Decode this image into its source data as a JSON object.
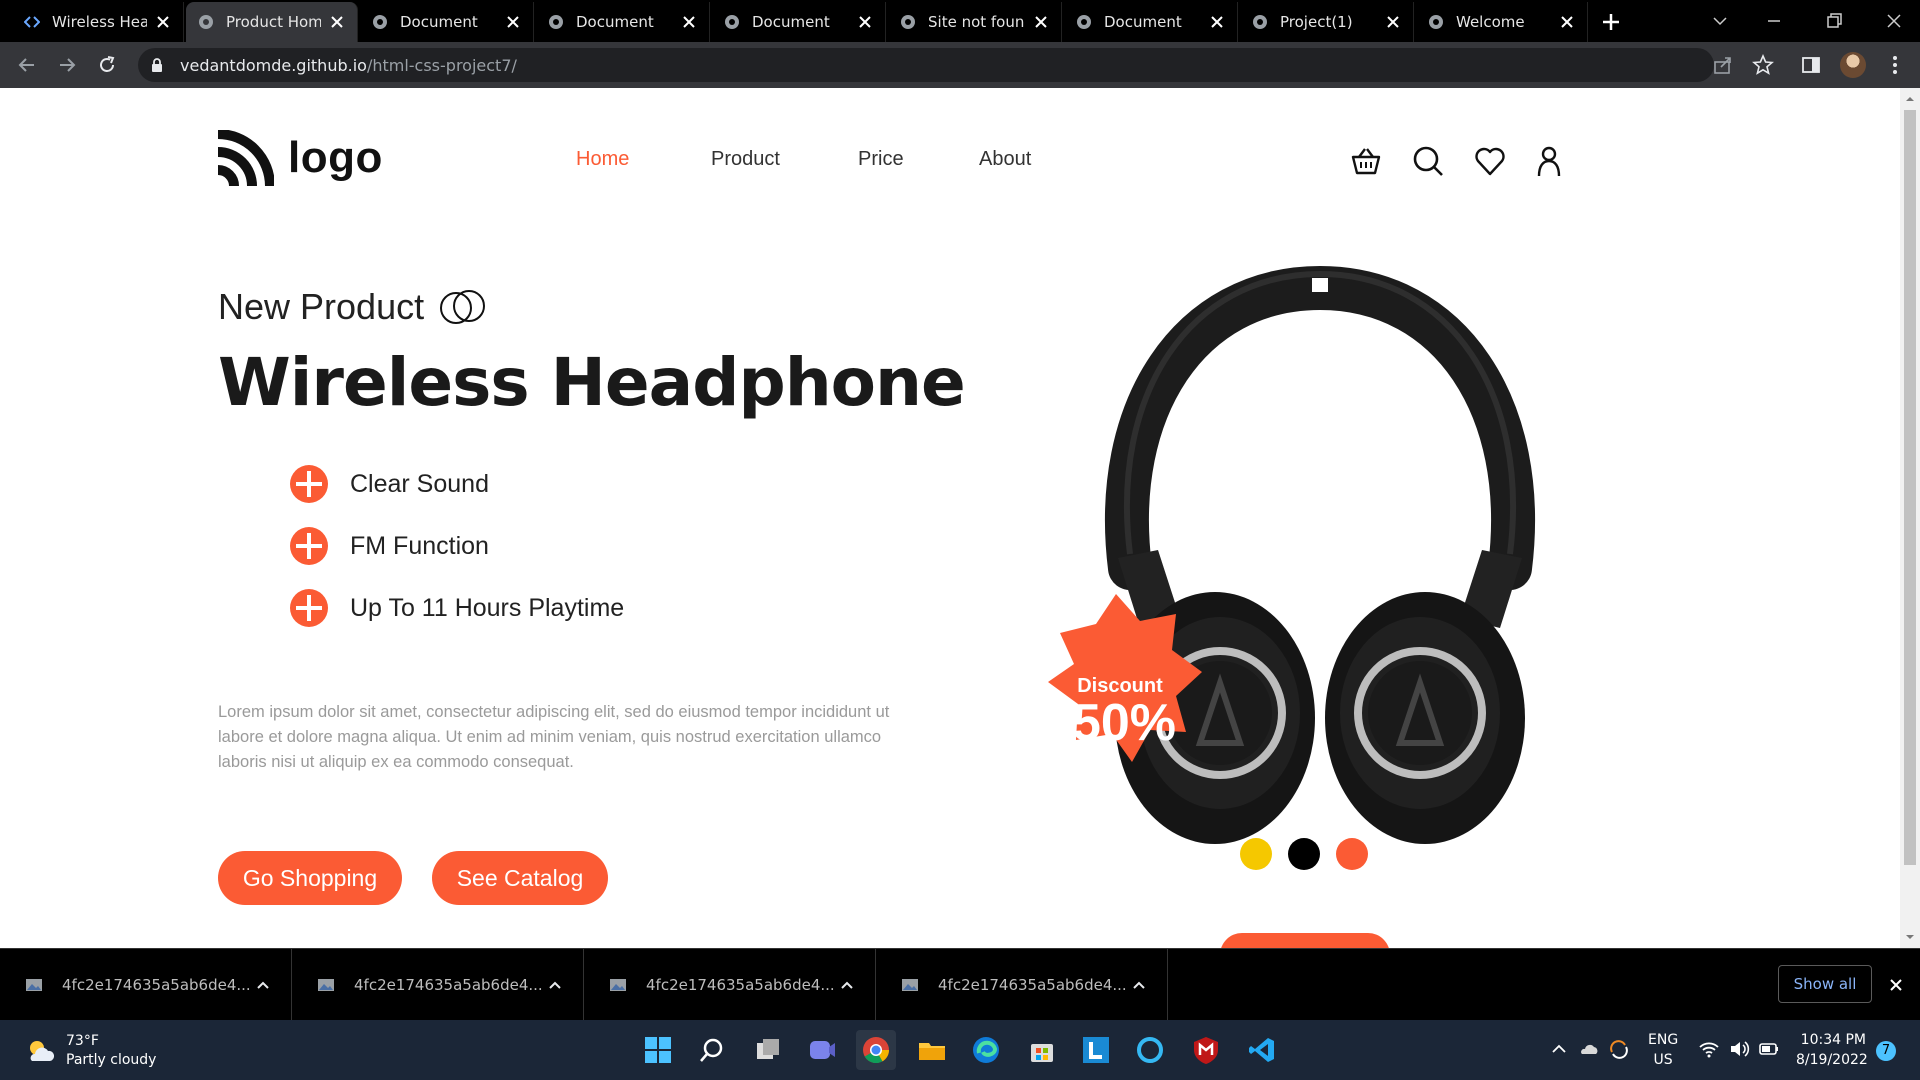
{
  "browser": {
    "tabs": [
      {
        "title": "Wireless Head",
        "active": false,
        "icon": "code-icon"
      },
      {
        "title": "Product Home",
        "active": true,
        "icon": "globe-icon"
      },
      {
        "title": "Document",
        "active": false,
        "icon": "globe-icon"
      },
      {
        "title": "Document",
        "active": false,
        "icon": "globe-icon"
      },
      {
        "title": "Document",
        "active": false,
        "icon": "globe-icon"
      },
      {
        "title": "Site not found",
        "active": false,
        "icon": "globe-icon"
      },
      {
        "title": "Document",
        "active": false,
        "icon": "globe-icon"
      },
      {
        "title": "Project(1)",
        "active": false,
        "icon": "globe-icon"
      },
      {
        "title": "Welcome",
        "active": false,
        "icon": "globe-icon"
      }
    ],
    "url_domain": "vedantdomde.github.io",
    "url_path": "/html-css-project7/"
  },
  "site": {
    "logo_text": "logo",
    "nav": [
      {
        "label": "Home",
        "active": true
      },
      {
        "label": "Product",
        "active": false
      },
      {
        "label": "Price",
        "active": false
      },
      {
        "label": "About",
        "active": false
      }
    ],
    "header_icons": [
      "basket-icon",
      "search-icon",
      "heart-icon",
      "user-icon"
    ],
    "hero": {
      "eyebrow": "New Product",
      "title": "Wireless Headphone",
      "features": [
        "Clear Sound",
        "FM Function",
        "Up To 11 Hours Playtime"
      ],
      "description": "Lorem ipsum dolor sit amet, consectetur adipiscing elit, sed do eiusmod tempor incididunt ut labore et dolore magna aliqua. Ut enim ad minim veniam, quis nostrud exercitation ullamco laboris nisi ut aliquip ex ea commodo consequat.",
      "buttons": [
        "Go Shopping",
        "See Catalog"
      ],
      "badge_label": "Discount",
      "badge_value": "50%",
      "color_swatches": [
        "#f5c800",
        "#000000",
        "#fb5b34"
      ]
    },
    "accent_color": "#fb5b34"
  },
  "downloads": {
    "items": [
      "4fc2e174635a5ab6de4...",
      "4fc2e174635a5ab6de4...",
      "4fc2e174635a5ab6de4...",
      "4fc2e174635a5ab6de4..."
    ],
    "show_all": "Show all"
  },
  "taskbar": {
    "weather_temp": "73°F",
    "weather_desc": "Partly cloudy",
    "lang_top": "ENG",
    "lang_bottom": "US",
    "time": "10:34 PM",
    "date": "8/19/2022",
    "notification_count": "7"
  }
}
